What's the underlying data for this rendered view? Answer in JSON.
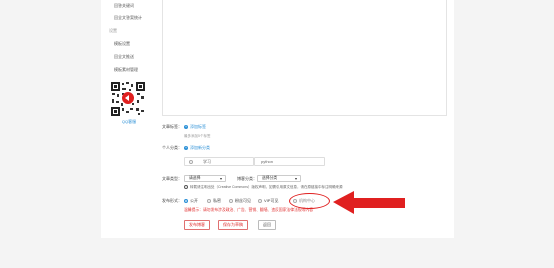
{
  "sidebar": {
    "items": [
      {
        "label": "回答关键词"
      },
      {
        "label": "回全文答案统计"
      },
      {
        "label": "设置"
      },
      {
        "label": "模板设置"
      },
      {
        "label": "回全文推送"
      },
      {
        "label": "模板素材管理"
      }
    ],
    "qr_label": "QQ客服"
  },
  "form": {
    "tags": {
      "label": "文章标签：",
      "action": "添加标签",
      "hint": "最多添加5个标签"
    },
    "category": {
      "label": "个人分类：",
      "action": "添加新分类",
      "value_left": "学习",
      "value_right": "python"
    },
    "article_type": {
      "label": "文章类型：",
      "select_value": "请选择",
      "blog_label": "博客分类：",
      "blog_select": "选择分类"
    },
    "license_note": "转载请注明出处（Creative Commons）版权声明，如需引用原文信息，请在原链接中标注明确来源",
    "publish": {
      "label": "发布形式：",
      "options": [
        "公开",
        "私密",
        "粉丝可见",
        "VIP可见",
        "机构中心"
      ],
      "selected_index": 0
    },
    "warning": "温馨提示：请勿发布涉及政治、广告、营销、翻墙、违反国家法律法规等内容",
    "buttons": {
      "publish": "发布博客",
      "save": "保存为草稿",
      "back": "返回"
    }
  },
  "colors": {
    "accent": "#2a8fd6",
    "danger": "#e02020",
    "annotation_arrow": "#e02020"
  }
}
